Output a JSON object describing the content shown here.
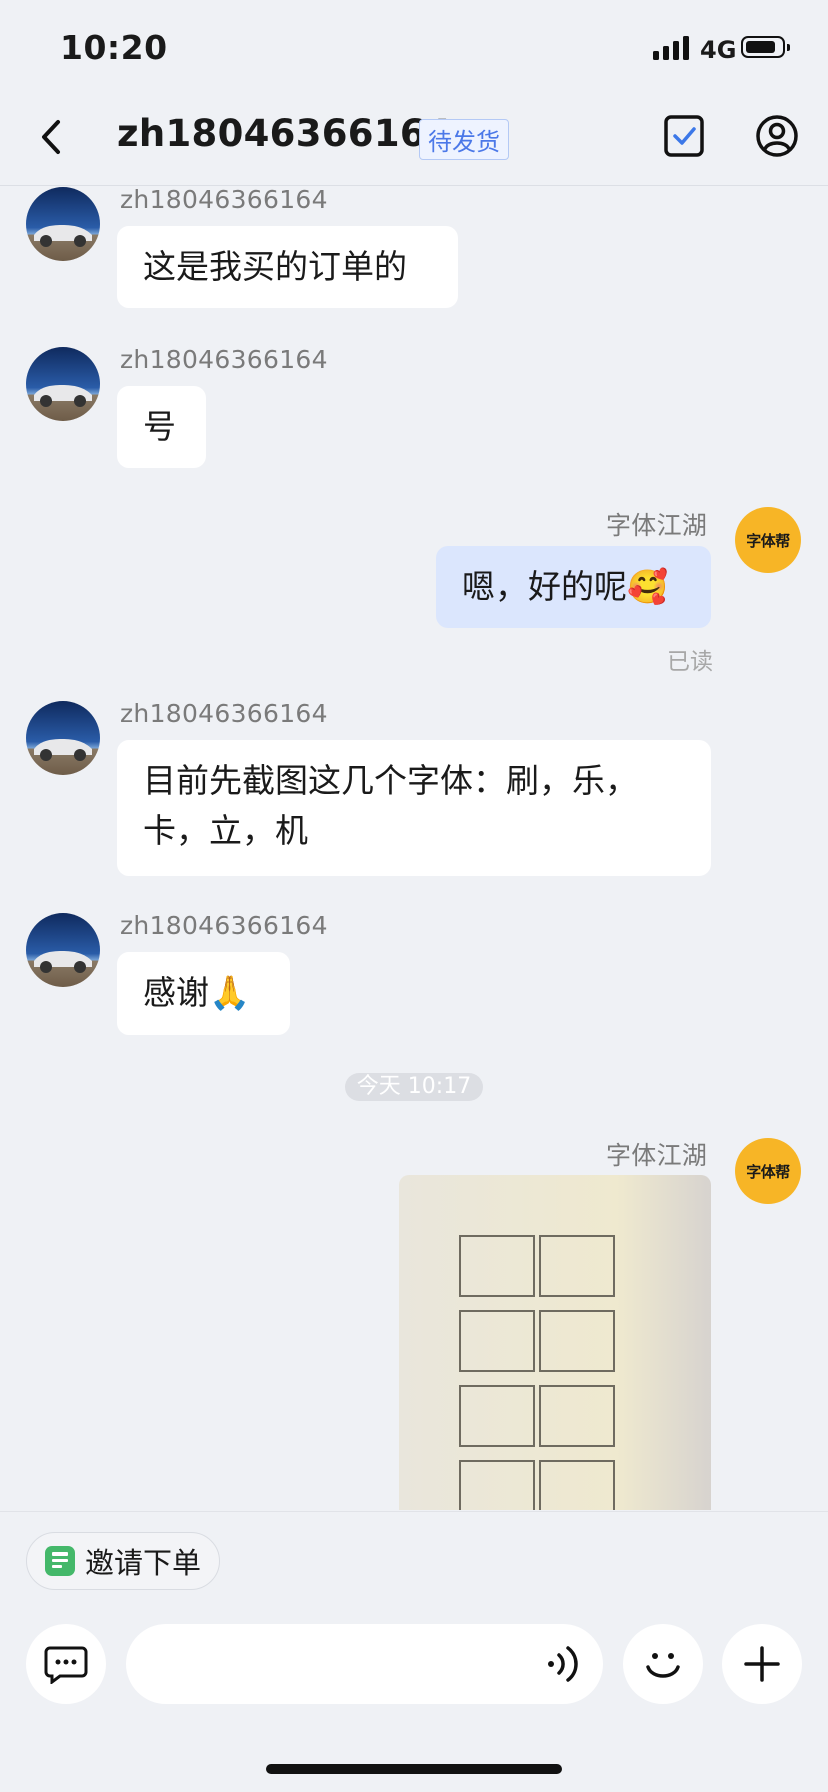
{
  "status_bar": {
    "time": "10:20",
    "network": "4G"
  },
  "header": {
    "title": "zh18046366164",
    "badge": "待发货",
    "back_icon": "chevron-left-icon",
    "task_icon": "checkbox-icon",
    "profile_icon": "user-circle-icon"
  },
  "messages": [
    {
      "sender": "zh18046366164",
      "text": "这是我买的订单的"
    },
    {
      "sender": "zh18046366164",
      "text": "号"
    },
    {
      "sender": "字体江湖",
      "text": "嗯，好的呢🥰",
      "status": "已读"
    },
    {
      "sender": "zh18046366164",
      "lines": [
        "目前先截图这几个字体：刷，乐，",
        "卡，立，机"
      ]
    },
    {
      "sender": "zh18046366164",
      "text": "感谢🙏"
    },
    {
      "sender": "字体江湖",
      "type": "image"
    }
  ],
  "brand_avatar_text": "字体帮",
  "timestamp": "今天 10:17",
  "bottom_bar": {
    "invite_label": "邀请下单",
    "keyboard_icon": "chat-keyboard-icon",
    "voice_icon": "voice-wave-icon",
    "emoji_icon": "smiley-icon",
    "plus_icon": "plus-icon"
  },
  "colors": {
    "background": "#eff1f5",
    "my_bubble": "#dbe6fd",
    "accent": "#4b78e8",
    "brand": "#f7b526"
  }
}
